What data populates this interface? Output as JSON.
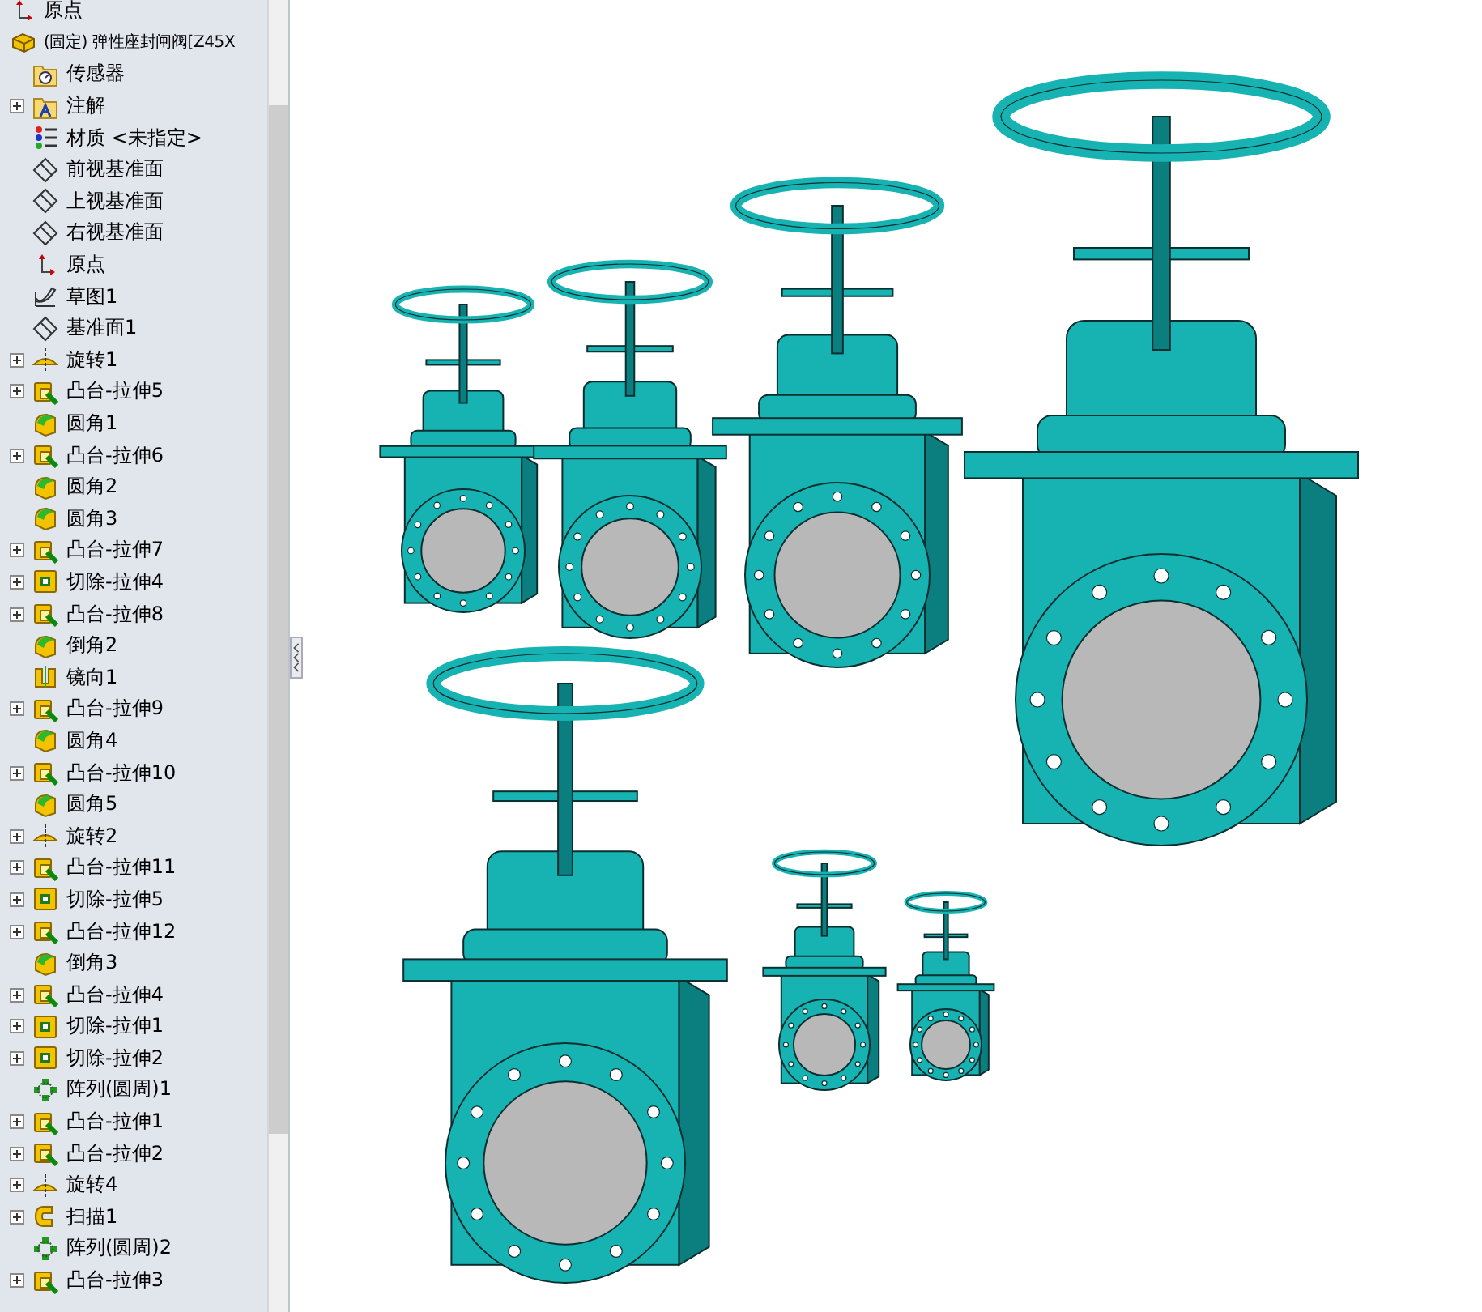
{
  "feature_tree": {
    "items": [
      {
        "label": "原点",
        "kind": "origin",
        "expandable": false
      },
      {
        "label": "(固定) 弹性座封闸阀[Z45X",
        "kind": "part",
        "expandable": false,
        "children": [
          {
            "label": "传感器",
            "kind": "sensor",
            "expandable": false
          },
          {
            "label": "注解",
            "kind": "annotation",
            "expandable": true
          },
          {
            "label": "材质 <未指定>",
            "kind": "material",
            "expandable": false
          },
          {
            "label": "前视基准面",
            "kind": "plane",
            "expandable": false
          },
          {
            "label": "上视基准面",
            "kind": "plane",
            "expandable": false
          },
          {
            "label": "右视基准面",
            "kind": "plane",
            "expandable": false
          },
          {
            "label": "原点",
            "kind": "origin",
            "expandable": false
          },
          {
            "label": "草图1",
            "kind": "sketch",
            "expandable": false
          },
          {
            "label": "基准面1",
            "kind": "plane",
            "expandable": false
          },
          {
            "label": "旋转1",
            "kind": "revolve",
            "expandable": true
          },
          {
            "label": "凸台-拉伸5",
            "kind": "boss",
            "expandable": true
          },
          {
            "label": "圆角1",
            "kind": "fillet",
            "expandable": false
          },
          {
            "label": "凸台-拉伸6",
            "kind": "boss",
            "expandable": true
          },
          {
            "label": "圆角2",
            "kind": "fillet",
            "expandable": false
          },
          {
            "label": "圆角3",
            "kind": "fillet",
            "expandable": false
          },
          {
            "label": "凸台-拉伸7",
            "kind": "boss",
            "expandable": true
          },
          {
            "label": "切除-拉伸4",
            "kind": "cut",
            "expandable": true
          },
          {
            "label": "凸台-拉伸8",
            "kind": "boss",
            "expandable": true
          },
          {
            "label": "倒角2",
            "kind": "fillet",
            "expandable": false
          },
          {
            "label": "镜向1",
            "kind": "mirror",
            "expandable": false
          },
          {
            "label": "凸台-拉伸9",
            "kind": "boss",
            "expandable": true
          },
          {
            "label": "圆角4",
            "kind": "fillet",
            "expandable": false
          },
          {
            "label": "凸台-拉伸10",
            "kind": "boss",
            "expandable": true
          },
          {
            "label": "圆角5",
            "kind": "fillet",
            "expandable": false
          },
          {
            "label": "旋转2",
            "kind": "revolve",
            "expandable": true
          },
          {
            "label": "凸台-拉伸11",
            "kind": "boss",
            "expandable": true
          },
          {
            "label": "切除-拉伸5",
            "kind": "cut",
            "expandable": true
          },
          {
            "label": "凸台-拉伸12",
            "kind": "boss",
            "expandable": true
          },
          {
            "label": "倒角3",
            "kind": "fillet",
            "expandable": false
          },
          {
            "label": "凸台-拉伸4",
            "kind": "boss",
            "expandable": true
          },
          {
            "label": "切除-拉伸1",
            "kind": "cut",
            "expandable": true
          },
          {
            "label": "切除-拉伸2",
            "kind": "cut",
            "expandable": true
          },
          {
            "label": "阵列(圆周)1",
            "kind": "pattern",
            "expandable": false
          },
          {
            "label": "凸台-拉伸1",
            "kind": "boss",
            "expandable": true
          },
          {
            "label": "凸台-拉伸2",
            "kind": "boss",
            "expandable": true
          },
          {
            "label": "旋转4",
            "kind": "revolve",
            "expandable": true
          },
          {
            "label": "扫描1",
            "kind": "sweep",
            "expandable": true
          },
          {
            "label": "阵列(圆周)2",
            "kind": "pattern",
            "expandable": false
          },
          {
            "label": "凸台-拉伸3",
            "kind": "boss",
            "expandable": true
          }
        ]
      }
    ]
  }
}
